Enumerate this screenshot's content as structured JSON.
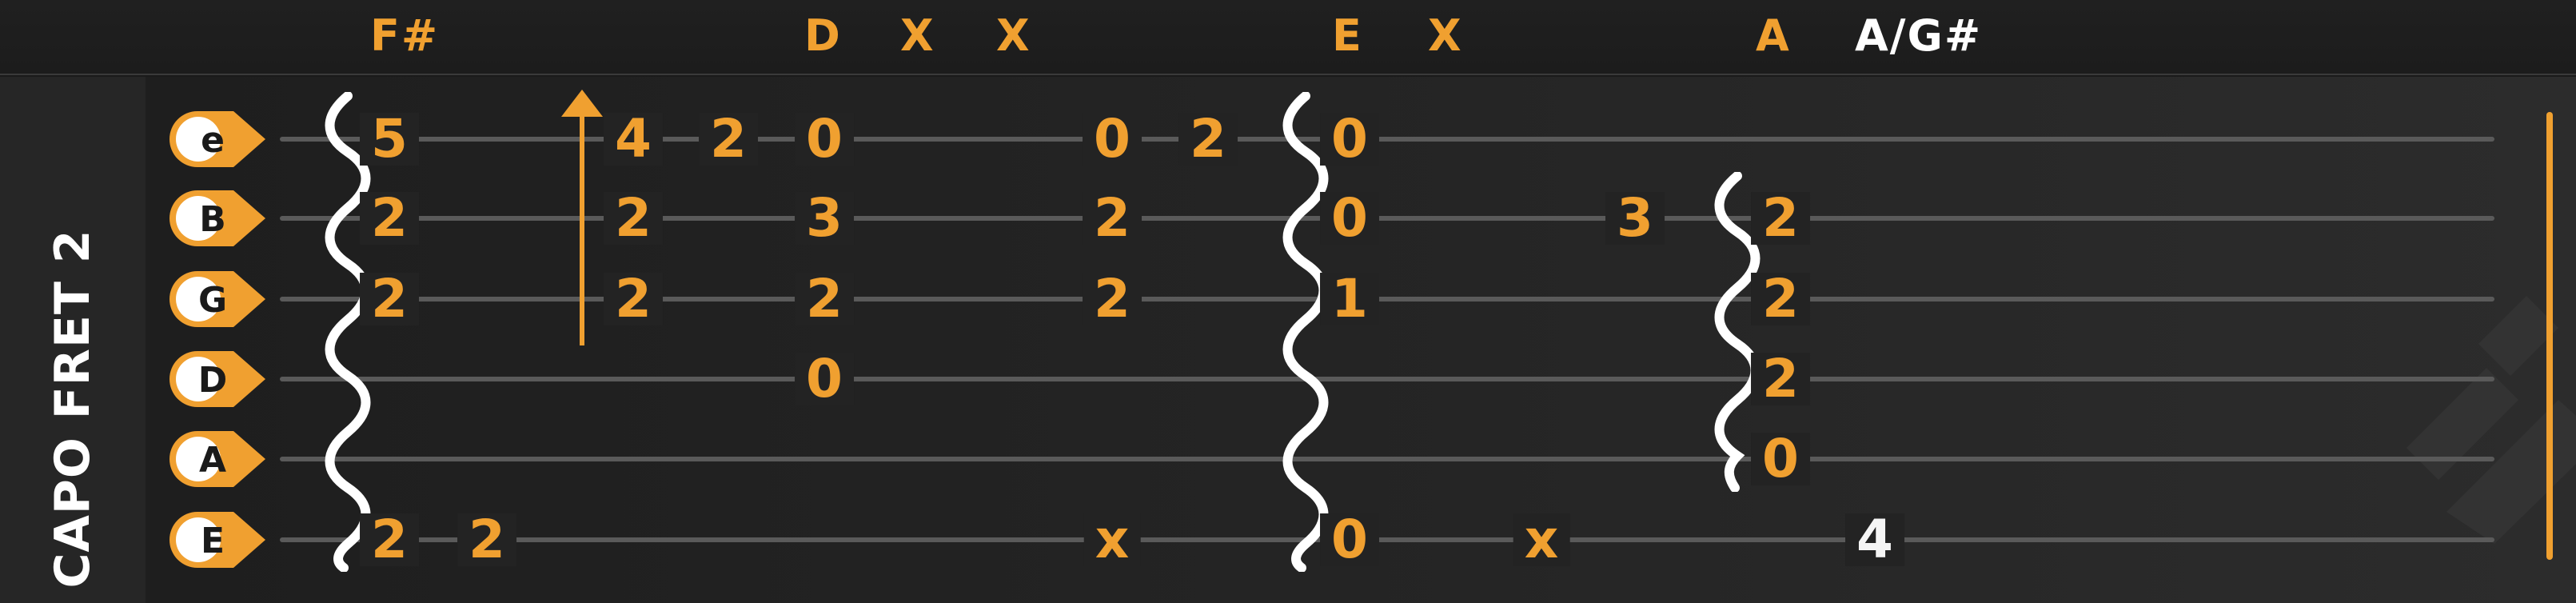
{
  "chords": [
    {
      "name": "F#",
      "color": "#f0a030"
    },
    {
      "name": "D",
      "color": "#f0a030"
    },
    {
      "name": "X",
      "color": "#f0a030"
    },
    {
      "name": "X",
      "color": "#f0a030"
    },
    {
      "name": "E",
      "color": "#f0a030"
    },
    {
      "name": "X",
      "color": "#f0a030"
    },
    {
      "name": "A",
      "color": "#f0a030"
    },
    {
      "name": "A/G#",
      "color": "#ffffff"
    }
  ],
  "capo_label": "CAPO FRET 2",
  "strings": [
    "e",
    "B",
    "G",
    "D",
    "A",
    "E"
  ],
  "accent_color": "#f0a030",
  "notes": {
    "e": [
      "5",
      "4",
      "2",
      "0",
      "0",
      "2",
      "0"
    ],
    "B": [
      "2",
      "2",
      "3",
      "2",
      "0",
      "3",
      "2"
    ],
    "G": [
      "2",
      "2",
      "2",
      "2",
      "1",
      "2"
    ],
    "D": [
      "0",
      "2"
    ],
    "A": [
      "0"
    ],
    "E": [
      "2",
      "2",
      "x",
      "0",
      "x",
      "4"
    ]
  },
  "icons": {
    "strum": "wavy-strum-icon",
    "arrow": "bend-arrow-icon",
    "logo": "watermark-logo-icon"
  }
}
